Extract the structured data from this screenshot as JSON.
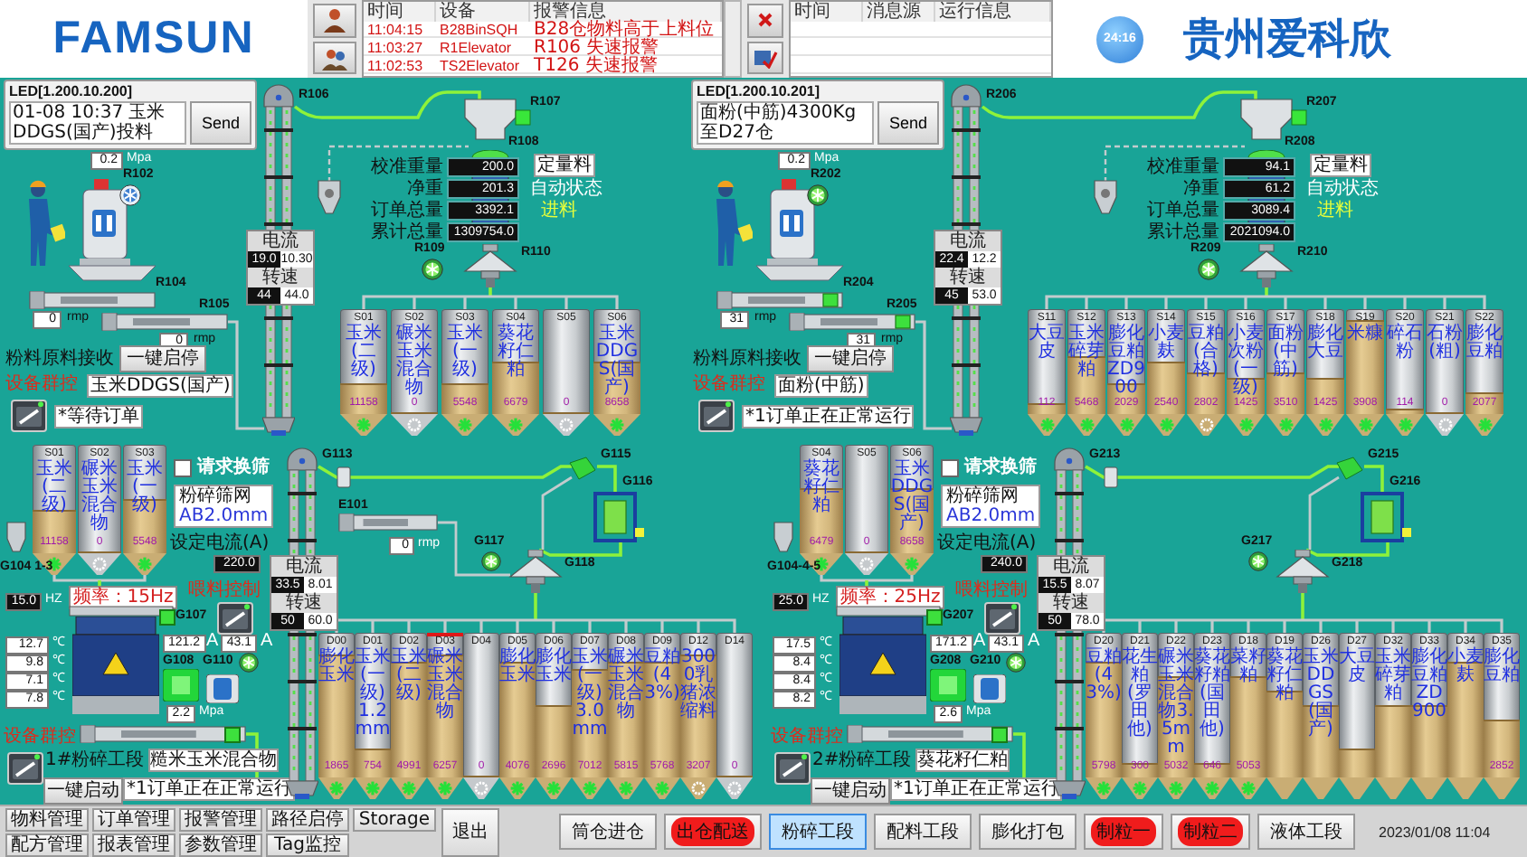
{
  "header": {
    "logo": "FAMSUN",
    "alarm_table": {
      "columns": [
        "时间",
        "设备",
        "报警信息"
      ],
      "rows": [
        {
          "time": "11:04:15",
          "device": "B28BinSQH",
          "message": "B28仓物料高于上料位"
        },
        {
          "time": "11:03:27",
          "device": "R1Elevator",
          "message": "R106 失速报警"
        },
        {
          "time": "11:02:53",
          "device": "TS2Elevator",
          "message": "T126 失速报警"
        }
      ]
    },
    "event_table": {
      "columns": [
        "时间",
        "消息源",
        "运行信息"
      ]
    },
    "clock": "24:16",
    "company": "贵州爱科欣"
  },
  "intake_lines": [
    {
      "led": {
        "title": "LED[1.200.10.200]",
        "message": "01-08 10:37 玉米DDGS(国产)投料",
        "button": "Send"
      },
      "pressure": {
        "value": "0.2",
        "unit": "Mpa"
      },
      "mixer_tag": "R102",
      "fan_running": false,
      "conveyors": [
        {
          "tag": "R104",
          "speed": "0",
          "unit": "rmp",
          "running": false
        },
        {
          "tag": "R105",
          "speed": "0",
          "unit": "rmp",
          "running": false
        }
      ],
      "elevator": {
        "tag": "R106",
        "readings": [
          {
            "label": "电流",
            "value": "19.0",
            "setpoint": "10.30"
          },
          {
            "label": "转速",
            "value": "44",
            "setpoint": "44.0"
          }
        ]
      },
      "cleaner_tag": "R107",
      "scale": {
        "tag": "R108",
        "readings": [
          {
            "label": "校准重量",
            "value": "200.0"
          },
          {
            "label": "净重",
            "value": "201.3"
          },
          {
            "label": "订单总量",
            "value": "3392.1"
          },
          {
            "label": "累计总量",
            "value": "1309754.0"
          }
        ],
        "mode": "定量料",
        "state": "自动状态",
        "action": "进料"
      },
      "fan_tag": "R109",
      "distributor_tag": "R110",
      "intake": {
        "title": "粉料原料接收",
        "button": "一键启停",
        "group_label": "设备群控",
        "product": "玉米DDGS(国产)",
        "status": "*等待订单"
      },
      "bins": [
        {
          "code": "S01",
          "name": "玉米(二级)",
          "value": "11158",
          "level": 0.3,
          "active": true
        },
        {
          "code": "S02",
          "name": "碾米玉米混合物",
          "value": "0",
          "level": 0,
          "active": false
        },
        {
          "code": "S03",
          "name": "玉米(一级)",
          "value": "5548",
          "level": 0.3,
          "active": true
        },
        {
          "code": "S04",
          "name": "葵花籽仁粕",
          "value": "6679",
          "level": 0.5,
          "active": true
        },
        {
          "code": "S05",
          "value": "0",
          "level": 0,
          "active": false
        },
        {
          "code": "S06",
          "name": "玉米DDGS(国产)",
          "value": "8658",
          "level": 0.5,
          "active": true
        }
      ]
    },
    {
      "led": {
        "title": "LED[1.200.10.201]",
        "message": "面粉(中筋)4300Kg至D27仓",
        "button": "Send"
      },
      "pressure": {
        "value": "0.2",
        "unit": "Mpa"
      },
      "mixer_tag": "R202",
      "fan_running": true,
      "conveyors": [
        {
          "tag": "R204",
          "speed": "31",
          "unit": "rmp",
          "running": true
        },
        {
          "tag": "R205",
          "speed": "31",
          "unit": "rmp",
          "running": true
        }
      ],
      "elevator": {
        "tag": "R206",
        "readings": [
          {
            "label": "电流",
            "value": "22.4",
            "setpoint": "12.2"
          },
          {
            "label": "转速",
            "value": "45",
            "setpoint": "53.0"
          }
        ]
      },
      "cleaner_tag": "R207",
      "scale": {
        "tag": "R208",
        "readings": [
          {
            "label": "校准重量",
            "value": "94.1"
          },
          {
            "label": "净重",
            "value": "61.2"
          },
          {
            "label": "订单总量",
            "value": "3089.4"
          },
          {
            "label": "累计总量",
            "value": "2021094.0"
          }
        ],
        "mode": "定量料",
        "state": "自动状态",
        "action": "进料"
      },
      "fan_tag": "R209",
      "distributor_tag": "R210",
      "intake": {
        "title": "粉料原料接收",
        "button": "一键启停",
        "group_label": "设备群控",
        "product": "面粉(中筋)",
        "status": "*1订单正在正常运行"
      },
      "bins": [
        {
          "code": "S11",
          "name": "大豆皮",
          "value": "112",
          "level": 0.1,
          "active": true
        },
        {
          "code": "S12",
          "name": "玉米碎芽粕",
          "value": "5468",
          "level": 0.55,
          "active": true
        },
        {
          "code": "S13",
          "name": "膨化豆粕ZD900",
          "value": "2029",
          "level": 0.3,
          "active": true
        },
        {
          "code": "S14",
          "name": "小麦麸",
          "value": "2540",
          "level": 0.5,
          "active": true
        },
        {
          "code": "S15",
          "name": "豆粕(合格)",
          "value": "2802",
          "level": 0.4,
          "active": false
        },
        {
          "code": "S16",
          "name": "小麦次粉(一级)",
          "value": "1425",
          "level": 0.35,
          "active": true
        },
        {
          "code": "S17",
          "name": "面粉(中筋)",
          "value": "3510",
          "level": 0.4,
          "active": true
        },
        {
          "code": "S18",
          "name": "膨化大豆",
          "value": "1425",
          "level": 0.35,
          "active": true
        },
        {
          "code": "S19",
          "name": "米糠",
          "value": "3908",
          "level": 0.9,
          "active": true
        },
        {
          "code": "S20",
          "name": "碎石粉",
          "value": "114",
          "level": 0.05,
          "active": true
        },
        {
          "code": "S21",
          "name": "石粉(粗)",
          "value": "0",
          "level": 0,
          "active": false
        },
        {
          "code": "S22",
          "name": "膨化豆粕",
          "value": "2077",
          "level": 0.2,
          "active": true
        }
      ]
    }
  ],
  "grinding_lines": [
    {
      "feed_bins": [
        {
          "code": "S01",
          "name": "玉米(二级)",
          "value": "11158",
          "level": 0.4,
          "active": true
        },
        {
          "code": "S02",
          "name": "碾米玉米混合物",
          "value": "0",
          "level": 0,
          "active": false
        },
        {
          "code": "S03",
          "name": "玉米(一级)",
          "value": "5548",
          "level": 0.5,
          "active": true
        }
      ],
      "feed_tag": "G104 1-3",
      "screen_request": {
        "label": "请求换筛",
        "checked": false
      },
      "screen": {
        "label": "粉碎筛网",
        "value": "AB2.0mm"
      },
      "current_setpoint": {
        "label": "设定电流(A)",
        "value": "220.0"
      },
      "feed_control": "喂料控制",
      "frequency": {
        "value": "15.0",
        "unit": "HZ"
      },
      "feeder_display": "频率：15Hz",
      "feeder_tag": "G107",
      "crusher_current": {
        "value": "121.2",
        "unit": "A"
      },
      "motor_tag": "G108",
      "fan": {
        "tag": "G110",
        "current": "43.1",
        "unit": "A"
      },
      "temperatures": [
        {
          "value": "12.7",
          "unit": "℃"
        },
        {
          "value": "9.8",
          "unit": "℃"
        },
        {
          "value": "7.1",
          "unit": "℃"
        },
        {
          "value": "7.8",
          "unit": "℃"
        }
      ],
      "pressure": {
        "value": "2.2",
        "unit": "Mpa"
      },
      "group_label": "设备群控",
      "section": "1#粉碎工段",
      "button": "一键启动",
      "product": "糙米玉米混合物",
      "status": "*1订单正在正常运行",
      "elevator": {
        "tag": "G113",
        "readings": [
          {
            "label": "电流",
            "value": "33.5",
            "setpoint": "8.01"
          },
          {
            "label": "转速",
            "value": "50",
            "setpoint": "60.0"
          }
        ]
      },
      "diverter_tag": "G115",
      "sifter_tag": "G116",
      "fan_tag": "G117",
      "distributor_tag": "G118",
      "conveyor": {
        "tag": "E101",
        "speed": "0",
        "unit": "rmp"
      },
      "bins": [
        {
          "code": "D00",
          "name": "膨化玉米",
          "value": "1865",
          "level": 0.85,
          "active": true,
          "alarm": false
        },
        {
          "code": "D01",
          "name": "玉米(一级)1.2mm",
          "value": "754",
          "level": 0.2,
          "active": true,
          "alarm": false
        },
        {
          "code": "D02",
          "name": "玉米(二级)",
          "value": "4991",
          "level": 0.8,
          "active": true,
          "alarm": false
        },
        {
          "code": "D03",
          "name": "碾米玉米混合物",
          "value": "6257",
          "level": 0.85,
          "active": true,
          "alarm": true
        },
        {
          "code": "D04",
          "value": "0",
          "level": 0,
          "active": false,
          "alarm": false
        },
        {
          "code": "D05",
          "name": "膨化玉米",
          "value": "4076",
          "level": 0.8,
          "active": true,
          "alarm": false
        },
        {
          "code": "D06",
          "name": "膨化玉米",
          "value": "2696",
          "level": 0.5,
          "active": true,
          "alarm": false
        },
        {
          "code": "D07",
          "name": "玉米(一级)3.0mm",
          "value": "7012",
          "level": 0.75,
          "active": true,
          "alarm": false
        },
        {
          "code": "D08",
          "name": "碾米玉米混合物",
          "value": "5815",
          "level": 0.8,
          "active": true,
          "alarm": false
        },
        {
          "code": "D09",
          "name": "豆粕(43%)",
          "value": "5768",
          "level": 0.8,
          "active": true,
          "alarm": false
        },
        {
          "code": "D12",
          "name": "3000乳猪浓缩料",
          "value": "3207",
          "level": 0.85,
          "active": false,
          "alarm": false
        },
        {
          "code": "D14",
          "value": "0",
          "level": 0,
          "active": false,
          "alarm": false
        }
      ]
    },
    {
      "feed_bins": [
        {
          "code": "S04",
          "name": "葵花籽仁粕",
          "value": "6479",
          "level": 0.6,
          "active": true
        },
        {
          "code": "S05",
          "value": "0",
          "level": 0,
          "active": false
        },
        {
          "code": "S06",
          "name": "玉米DDGS(国产)",
          "value": "8658",
          "level": 0.6,
          "active": true
        }
      ],
      "feed_tag": "G104-4-5",
      "screen_request": {
        "label": "请求换筛",
        "checked": false
      },
      "screen": {
        "label": "粉碎筛网",
        "value": "AB2.0mm"
      },
      "current_setpoint": {
        "label": "设定电流(A)",
        "value": "240.0"
      },
      "feed_control": "喂料控制",
      "frequency": {
        "value": "25.0",
        "unit": "HZ"
      },
      "feeder_display": "频率：25Hz",
      "feeder_tag": "G207",
      "crusher_current": {
        "value": "171.2",
        "unit": "A"
      },
      "motor_tag": "G208",
      "fan": {
        "tag": "G210",
        "current": "43.1",
        "unit": "A"
      },
      "temperatures": [
        {
          "value": "17.5",
          "unit": "℃"
        },
        {
          "value": "8.4",
          "unit": "℃"
        },
        {
          "value": "8.4",
          "unit": "℃"
        },
        {
          "value": "8.2",
          "unit": "℃"
        }
      ],
      "pressure": {
        "value": "2.6",
        "unit": "Mpa"
      },
      "group_label": "设备群控",
      "section": "2#粉碎工段",
      "button": "一键启动",
      "product": "葵花籽仁粕",
      "status": "*1订单正在正常运行",
      "elevator": {
        "tag": "G213",
        "readings": [
          {
            "label": "电流",
            "value": "15.5",
            "setpoint": "8.07"
          },
          {
            "label": "转速",
            "value": "50",
            "setpoint": "78.0"
          }
        ]
      },
      "diverter_tag": "G215",
      "sifter_tag": "G216",
      "fan_tag": "G217",
      "distributor_tag": "G218",
      "bins": [
        {
          "code": "D20",
          "name": "豆粕(43%)",
          "value": "5798",
          "level": 0.8,
          "active": true
        },
        {
          "code": "D21",
          "name": "花生粕(罗田他)",
          "value": "300",
          "level": 0.1,
          "active": true
        },
        {
          "code": "D22",
          "name": "碾米玉米混合物3.5mm",
          "value": "5032",
          "level": 0.7,
          "active": true
        },
        {
          "code": "D23",
          "name": "葵花籽粕(国田他)",
          "value": "646",
          "level": 0.1,
          "active": true
        },
        {
          "code": "D18",
          "name": "菜籽粕",
          "value": "5053",
          "level": 0.7,
          "active": true
        },
        {
          "code": "D19",
          "name": "葵花籽仁粕",
          "level": 0.6
        },
        {
          "code": "D26",
          "name": "玉米DDGS(国产)",
          "level": 0.5
        },
        {
          "code": "D27",
          "name": "大豆皮",
          "level": 0.2
        },
        {
          "code": "D32",
          "name": "玉米碎芽粕",
          "level": 0.5
        },
        {
          "code": "D33",
          "name": "膨化豆粕ZD900",
          "level": 0.5
        },
        {
          "code": "D34",
          "name": "小麦麸",
          "level": 0.8
        },
        {
          "code": "D35",
          "name": "膨化豆粕",
          "value": "2852",
          "level": 0.4
        }
      ]
    }
  ],
  "toolbar": {
    "menu": [
      "物料管理",
      "订单管理",
      "报警管理",
      "路径启停",
      "Storage",
      "配方管理",
      "报表管理",
      "参数管理",
      "Tag监控"
    ],
    "exit": "退出",
    "sections": [
      {
        "label": "筒仓进仓",
        "selected": false,
        "alarm": false
      },
      {
        "label": "出仓配送",
        "selected": false,
        "alarm": true
      },
      {
        "label": "粉碎工段",
        "selected": true,
        "alarm": false
      },
      {
        "label": "配料工段",
        "selected": false,
        "alarm": false
      },
      {
        "label": "膨化打包",
        "selected": false,
        "alarm": false
      },
      {
        "label": "制粒一",
        "selected": false,
        "alarm": true
      },
      {
        "label": "制粒二",
        "selected": false,
        "alarm": true
      },
      {
        "label": "液体工段",
        "selected": false,
        "alarm": false
      }
    ],
    "datetime": "2023/01/08 11:04"
  }
}
